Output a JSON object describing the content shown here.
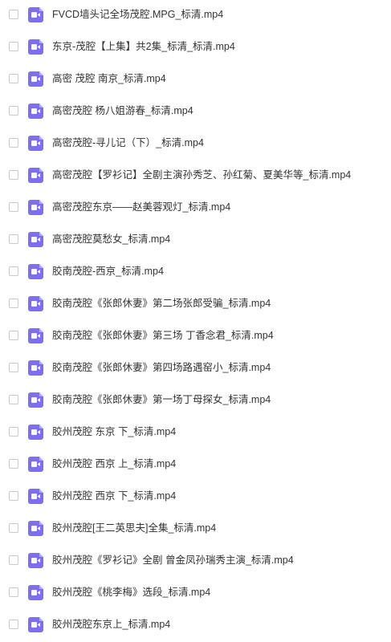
{
  "files": [
    {
      "name": "FVCD墙头记全场茂腔.MPG_标清.mp4",
      "icon": "video-file-icon"
    },
    {
      "name": "东京-茂腔【上集】共2集_标清_标清.mp4",
      "icon": "video-file-icon"
    },
    {
      "name": "高密 茂腔  南京_标清.mp4",
      "icon": "video-file-icon"
    },
    {
      "name": "高密茂腔 杨八姐游春_标清.mp4",
      "icon": "video-file-icon"
    },
    {
      "name": "高密茂腔-寻儿记（下）_标清.mp4",
      "icon": "video-file-icon"
    },
    {
      "name": "高密茂腔【罗衫记】全剧主演孙秀芝、孙红菊、夏美华等_标清.mp4",
      "icon": "video-file-icon"
    },
    {
      "name": "高密茂腔东京——赵美蓉观灯_标清.mp4",
      "icon": "video-file-icon"
    },
    {
      "name": "高密茂腔莫愁女_标清.mp4",
      "icon": "video-file-icon"
    },
    {
      "name": "胶南茂腔-西京_标清.mp4",
      "icon": "video-file-icon"
    },
    {
      "name": "胶南茂腔《张郎休妻》第二场张郎受骗_标清.mp4",
      "icon": "video-file-icon"
    },
    {
      "name": "胶南茂腔《张郎休妻》第三场 丁香念君_标清.mp4",
      "icon": "video-file-icon"
    },
    {
      "name": "胶南茂腔《张郎休妻》第四场路遇窑小_标清.mp4",
      "icon": "video-file-icon"
    },
    {
      "name": "胶南茂腔《张郎休妻》第一场丁母探女_标清.mp4",
      "icon": "video-file-icon"
    },
    {
      "name": "胶州茂腔 东京 下_标清.mp4",
      "icon": "video-file-icon"
    },
    {
      "name": "胶州茂腔 西京 上_标清.mp4",
      "icon": "video-file-icon"
    },
    {
      "name": "胶州茂腔 西京 下_标清.mp4",
      "icon": "video-file-icon"
    },
    {
      "name": "胶州茂腔[王二英思夫]全集_标清.mp4",
      "icon": "video-file-icon"
    },
    {
      "name": "胶州茂腔《罗衫记》全剧 曾金凤孙瑞秀主演_标清.mp4",
      "icon": "video-file-icon"
    },
    {
      "name": "胶州茂腔《桃李梅》选段_标清.mp4",
      "icon": "video-file-icon"
    },
    {
      "name": "胶州茂腔东京上_标清.mp4",
      "icon": "video-file-icon"
    }
  ],
  "colors": {
    "icon_bg": "#7c6ef3",
    "checkbox_border": "#c7c9cc",
    "text": "#333333"
  }
}
